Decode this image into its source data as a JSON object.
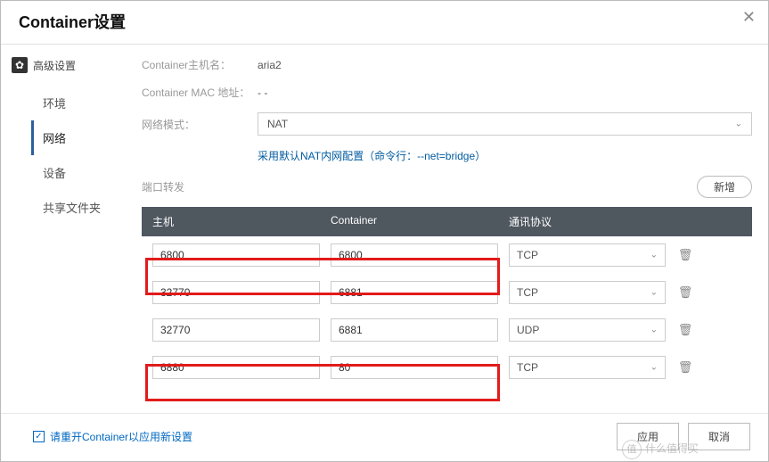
{
  "title": "Container设置",
  "close_icon": "✕",
  "advanced_label": "高级设置",
  "sidebar": {
    "items": [
      {
        "label": "环境"
      },
      {
        "label": "网络"
      },
      {
        "label": "设备"
      },
      {
        "label": "共享文件夹"
      }
    ],
    "active_index": 1
  },
  "fields": {
    "hostname_label": "Container主机名：",
    "hostname_value": "aria2",
    "mac_label": "Container MAC 地址：",
    "mac_value": "- -",
    "netmode_label": "网络模式：",
    "netmode_value": "NAT",
    "hint_text": "采用默认NAT内网配置（命令行：--net=bridge）",
    "portforward_label": "端口转发",
    "add_button": "新增"
  },
  "table": {
    "headers": {
      "host": "主机",
      "container": "Container",
      "protocol": "通讯协议"
    },
    "rows": [
      {
        "host": "6800",
        "container": "6800",
        "protocol": "TCP"
      },
      {
        "host": "32770",
        "container": "6881",
        "protocol": "TCP"
      },
      {
        "host": "32770",
        "container": "6881",
        "protocol": "UDP"
      },
      {
        "host": "6880",
        "container": "80",
        "protocol": "TCP"
      }
    ]
  },
  "footer": {
    "restart_label": "请重开Container以应用新设置",
    "apply": "应用",
    "cancel": "取消"
  },
  "watermark": "什么值得买"
}
